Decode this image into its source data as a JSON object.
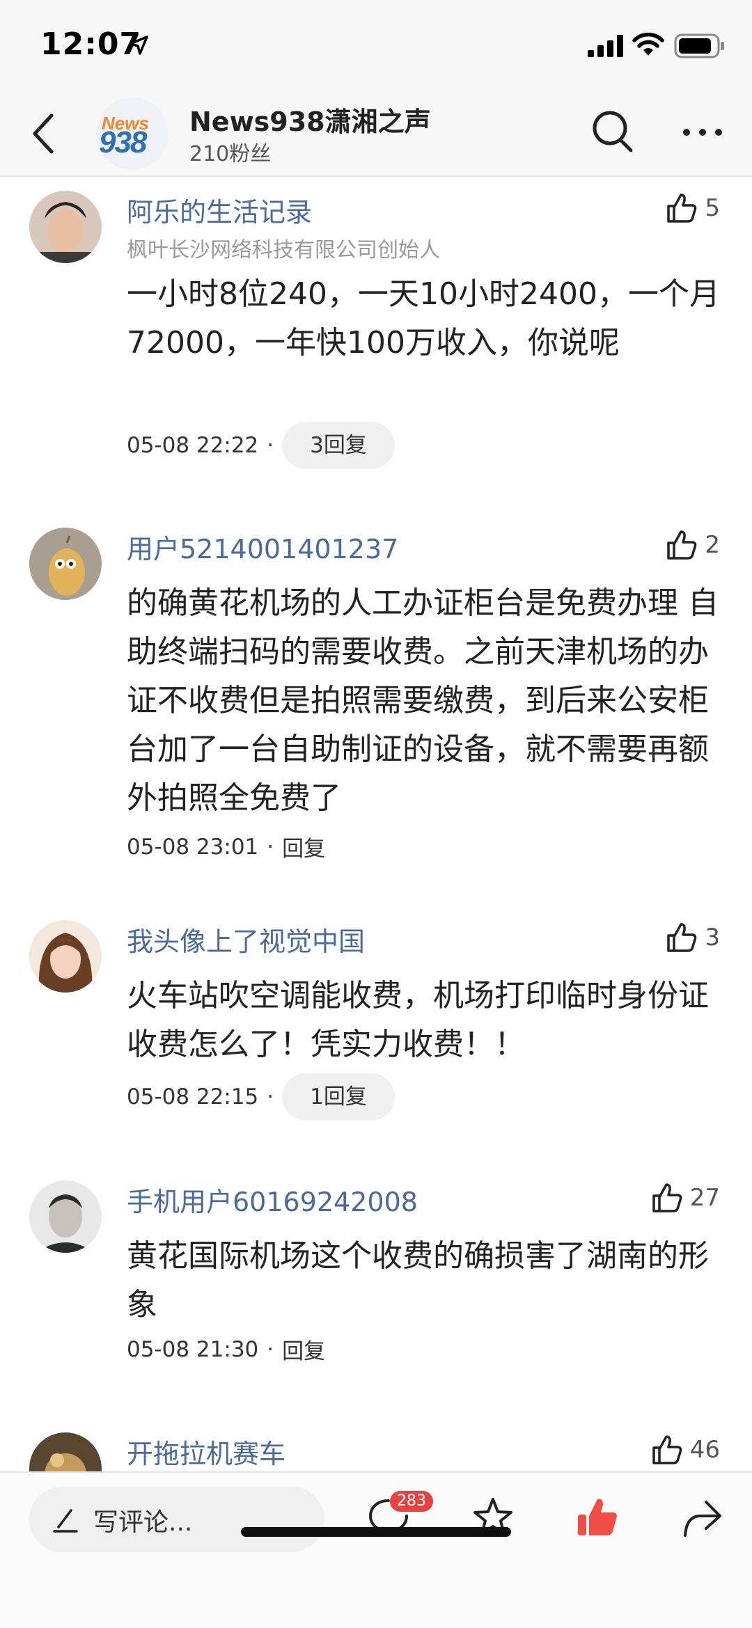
{
  "status": {
    "time": "12:07"
  },
  "header": {
    "logo_top": "News",
    "logo_bottom": "938",
    "name": "News938潇湘之声",
    "fans": "210粉丝"
  },
  "comments": [
    {
      "user": "阿乐的生活记录",
      "subtitle": "枫叶长沙网络科技有限公司创始人",
      "likes": "5",
      "text": "一小时8位240，一天10小时2400，一个月72000，一年快100万收入，你说呢",
      "time": "05-08 22:22",
      "reply": "3回复"
    },
    {
      "user": "用户5214001401237",
      "likes": "2",
      "text": "的确黄花机场的人工办证柜台是免费办理 自助终端扫码的需要收费。之前天津机场的办证不收费但是拍照需要缴费，到后来公安柜台加了一台自助制证的设备，就不需要再额外拍照全免费了",
      "time": "05-08 23:01",
      "reply": "回复"
    },
    {
      "user": "我头像上了视觉中国",
      "likes": "3",
      "text": "火车站吹空调能收费，机场打印临时身份证收费怎么了！凭实力收费！！",
      "time": "05-08 22:15",
      "reply": "1回复"
    },
    {
      "user": "手机用户60169242008",
      "likes": "27",
      "text": "黄花国际机场这个收费的确损害了湖南的形象",
      "time": "05-08 21:30",
      "reply": "回复"
    },
    {
      "user": "开拖拉机赛车",
      "likes": "46"
    }
  ],
  "bottom": {
    "write_placeholder": "写评论...",
    "comment_count": "283"
  }
}
